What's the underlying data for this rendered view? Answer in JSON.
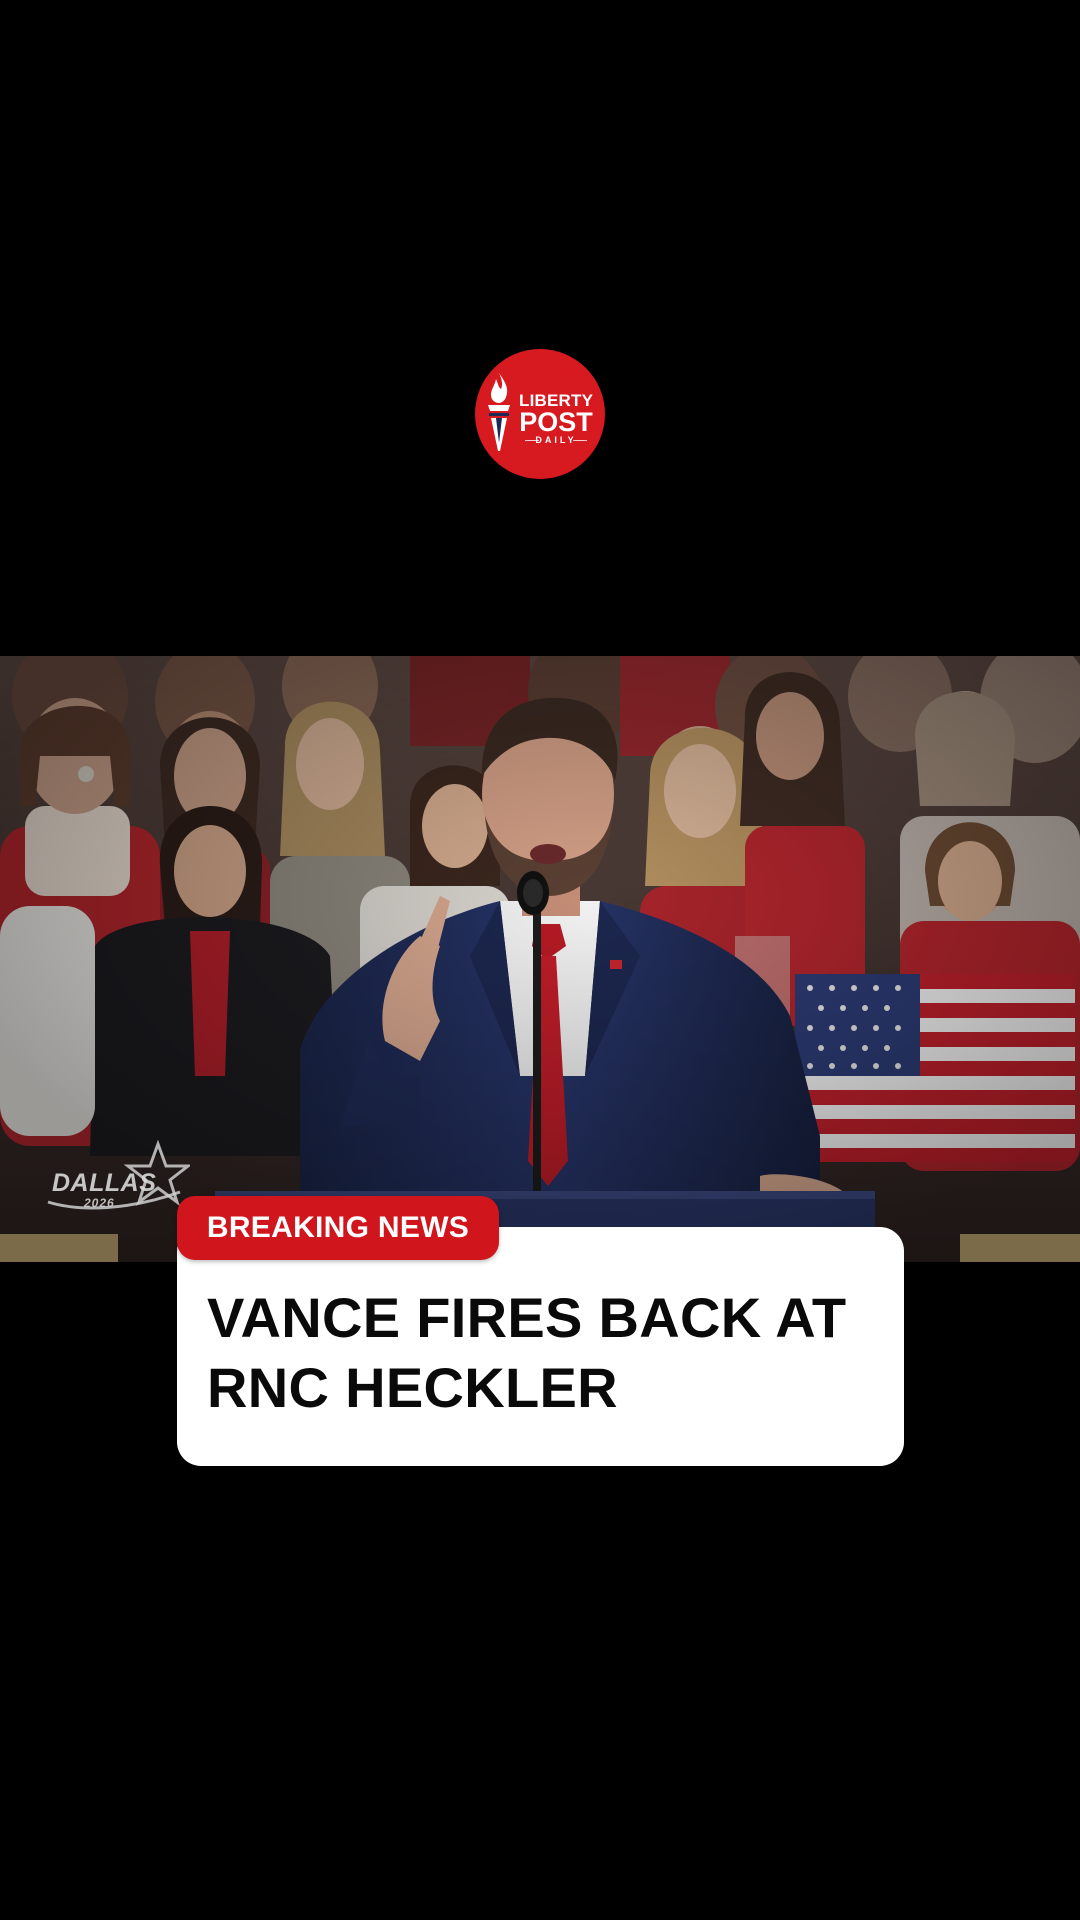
{
  "brand": {
    "line1": "LIBERTY",
    "line2": "POST",
    "line3": "DAILY",
    "color": "#d71920",
    "icon": "torch-icon"
  },
  "photo": {
    "watermark": {
      "word": "DALLAS",
      "year": "2026",
      "icon": "star-icon"
    }
  },
  "caption": {
    "badge": "BREAKING NEWS",
    "badge_color": "#d0151c",
    "headline": "VANCE FIRES BACK AT RNC HECKLER"
  }
}
